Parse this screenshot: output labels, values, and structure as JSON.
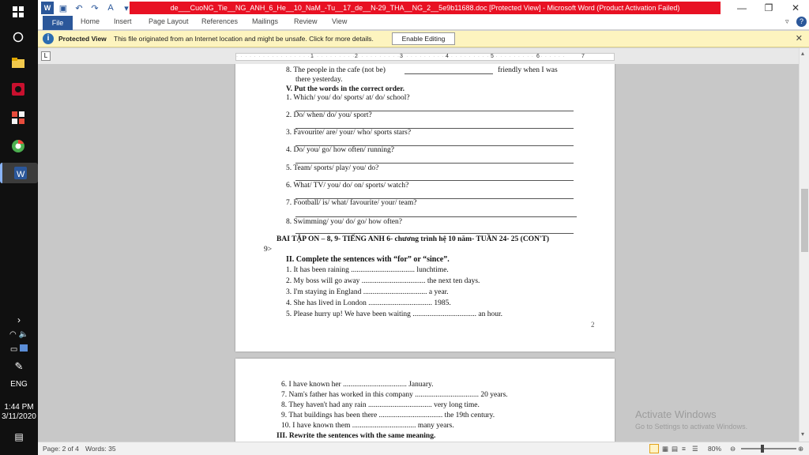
{
  "window": {
    "title": "de___CuoNG_Tie__NG_ANH_6_He__10_NaM_-Tu__17_de__N-29_THA__NG_2__5e9b11688.doc [Protected View] - Microsoft Word (Product Activation Failed)"
  },
  "taskbar": {
    "speaker_glyph": "🔈",
    "language": "ENG",
    "time": "1:44 PM",
    "date": "3/11/2020"
  },
  "ribbon": {
    "tabs": [
      "File",
      "Home",
      "Insert",
      "Page Layout",
      "References",
      "Mailings",
      "Review",
      "View"
    ]
  },
  "protected_view": {
    "title": "Protected View",
    "message": "This file originated from an Internet location and might be unsafe. Click for more details.",
    "button": "Enable Editing"
  },
  "ruler": {
    "numbers": [
      "1",
      "2",
      "3",
      "4",
      "5",
      "6",
      "7"
    ]
  },
  "document": {
    "page1": {
      "q8_line1_a": "8. The people in the cafe (not be)",
      "q8_line1_b": "friendly when I was",
      "q8_line2": "there yesterday.",
      "section5": "V. Put the words in the correct order.",
      "items": [
        "1. Which/ you/ do/ sports/ at/ do/ school?",
        "2. Do/ when/ do/ you/ sport?",
        "3. Favourite/ are/ your/ who/ sports stars?",
        "4. Do/ you/ go/ how often/ running?",
        "5. Team/ sports/ play/ you/ do?",
        "6. What/ TV/ you/ do/ on/ sports/ watch?",
        "7. Football/ is/ what/ favourite/ your/ team?",
        "8. Swimming/ you/ do/ go/ how often?"
      ],
      "heading": "BAI TẬP ON – 8, 9- TIẾNG ANH 6- chương trình hệ 10 năm- TUẦN 24- 25 (CON'T)",
      "heading_cont": "9>",
      "section2": "II. Complete the sentences with “for” or “since”.",
      "for_since": [
        "1. It has been raining .................................. lunchtime.",
        "2. My boss will go away .................................. the next ten days.",
        "3. I'm staying in England .................................. a year.",
        "4. She has lived in London .................................. 1985.",
        "5. Please hurry up! We have been waiting .................................. an hour."
      ],
      "page_number": "2"
    },
    "page2": {
      "lines": [
        "6. I have known her .................................. January.",
        "7. Nam's father has worked in this company .................................. 20 years.",
        "8. They haven't had any rain .................................. very long time.",
        "9. That buildings has been there .................................. the 19th century.",
        "10. I have known them .................................. many years."
      ],
      "section3": "III. Rewrite the sentences with the same meaning."
    }
  },
  "status": {
    "page": "Page: 2 of 4",
    "words": "Words: 35",
    "zoom": "80%"
  },
  "watermark": {
    "line1": "Activate Windows",
    "line2": "Go to Settings to activate Windows."
  }
}
